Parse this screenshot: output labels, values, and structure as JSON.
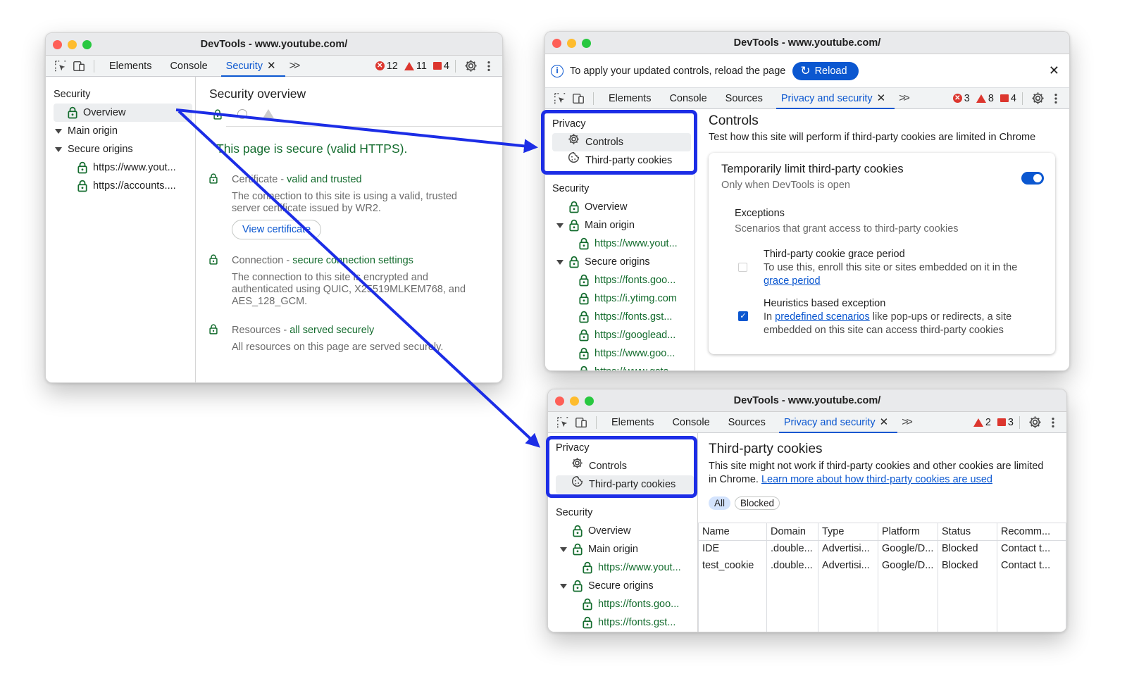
{
  "window1": {
    "title": "DevTools - www.youtube.com/",
    "tabs": [
      "Elements",
      "Console",
      "Security"
    ],
    "counts": {
      "errors": "12",
      "warnings": "11",
      "issues": "4"
    },
    "sidebar": {
      "header": "Security",
      "overview": "Overview",
      "main_origin": "Main origin",
      "secure_origins": "Secure origins",
      "origins": [
        "https://www.yout...",
        "https://accounts...."
      ]
    },
    "main": {
      "title": "Security overview",
      "secure_message": "This page is secure (valid HTTPS).",
      "certificate": {
        "label": "Certificate",
        "status": "valid and trusted",
        "desc": "The connection to this site is using a valid, trusted server certificate issued by WR2.",
        "button": "View certificate"
      },
      "connection": {
        "label": "Connection",
        "status": "secure connection settings",
        "desc": "The connection to this site is encrypted and authenticated using QUIC, X25519MLKEM768, and AES_128_GCM."
      },
      "resources": {
        "label": "Resources",
        "status": "all served securely",
        "desc": "All resources on this page are served securely."
      }
    }
  },
  "window2": {
    "title": "DevTools - www.youtube.com/",
    "infobar": {
      "text": "To apply your updated controls, reload the page",
      "button": "Reload"
    },
    "tabs": [
      "Elements",
      "Console",
      "Sources",
      "Privacy and security"
    ],
    "counts": {
      "errors": "3",
      "warnings": "8",
      "issues": "4"
    },
    "sidebar": {
      "privacy_header": "Privacy",
      "controls": "Controls",
      "third_party": "Third-party cookies",
      "security_header": "Security",
      "overview": "Overview",
      "main_origin": "Main origin",
      "main_origin_url": "https://www.yout...",
      "secure_origins": "Secure origins",
      "origins": [
        "https://fonts.goo...",
        "https://i.ytimg.com",
        "https://fonts.gst...",
        "https://googlead...",
        "https://www.goo...",
        "https://www.gsta..."
      ]
    },
    "main": {
      "title": "Controls",
      "subtitle": "Test how this site will perform if third-party cookies are limited in Chrome",
      "card": {
        "title": "Temporarily limit third-party cookies",
        "subtitle": "Only when DevTools is open",
        "exceptions_title": "Exceptions",
        "exceptions_sub": "Scenarios that grant access to third-party cookies",
        "grace_title": "Third-party cookie grace period",
        "grace_desc": "To use this, enroll this site or sites embedded on it in the",
        "grace_link": "grace period",
        "heur_title": "Heuristics based exception",
        "heur_pre": "In",
        "heur_link": "predefined scenarios",
        "heur_post": "like pop-ups or redirects, a site embedded on this site can access third-party cookies"
      }
    }
  },
  "window3": {
    "title": "DevTools - www.youtube.com/",
    "tabs": [
      "Elements",
      "Console",
      "Sources",
      "Privacy and security"
    ],
    "counts": {
      "warnings": "2",
      "issues": "3"
    },
    "sidebar": {
      "privacy_header": "Privacy",
      "controls": "Controls",
      "third_party": "Third-party cookies",
      "security_header": "Security",
      "overview": "Overview",
      "main_origin": "Main origin",
      "main_origin_url": "https://www.yout...",
      "secure_origins": "Secure origins",
      "origins": [
        "https://fonts.goo...",
        "https://fonts.gst..."
      ]
    },
    "main": {
      "title": "Third-party cookies",
      "desc": "This site might not work if third-party cookies and other cookies are limited in Chrome.",
      "learn_link": "Learn more about how third-party cookies are used",
      "filters": [
        "All",
        "Blocked"
      ],
      "columns": [
        "Name",
        "Domain",
        "Type",
        "Platform",
        "Status",
        "Recomm..."
      ],
      "rows": [
        [
          "IDE",
          ".double...",
          "Advertisi...",
          "Google/D...",
          "Blocked",
          "Contact t..."
        ],
        [
          "test_cookie",
          ".double...",
          "Advertisi...",
          "Google/D...",
          "Blocked",
          "Contact t..."
        ]
      ]
    }
  },
  "colors": {
    "accent": "#0b57d0",
    "secure_green": "#146c2e",
    "error_red": "#dc362e",
    "annotation_blue": "#1c2de6"
  }
}
